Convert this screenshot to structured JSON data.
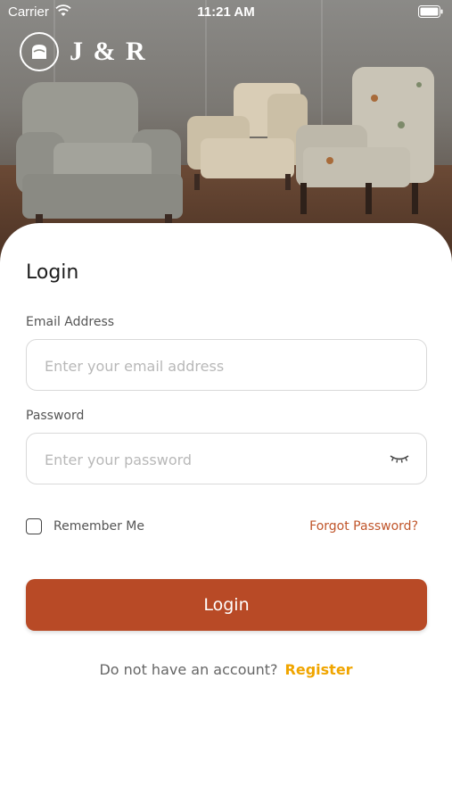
{
  "status_bar": {
    "carrier": "Carrier",
    "time": "11:21 AM"
  },
  "brand": {
    "name": "J & R"
  },
  "login": {
    "title": "Login",
    "email_label": "Email Address",
    "email_placeholder": "Enter your email address",
    "email_value": "",
    "password_label": "Password",
    "password_placeholder": "Enter your password",
    "password_value": "",
    "remember_label": "Remember Me",
    "remember_checked": false,
    "forgot_label": "Forgot Password?",
    "button_label": "Login",
    "no_account_text": "Do not have an account?",
    "register_label": "Register"
  },
  "icons": {
    "wifi": "wifi-icon",
    "battery": "battery-icon",
    "logo": "chair-emblem-icon",
    "password_toggle": "eye-closed-icon"
  },
  "colors": {
    "primary": "#b84a26",
    "link": "#c0552a",
    "register": "#f0a500"
  }
}
